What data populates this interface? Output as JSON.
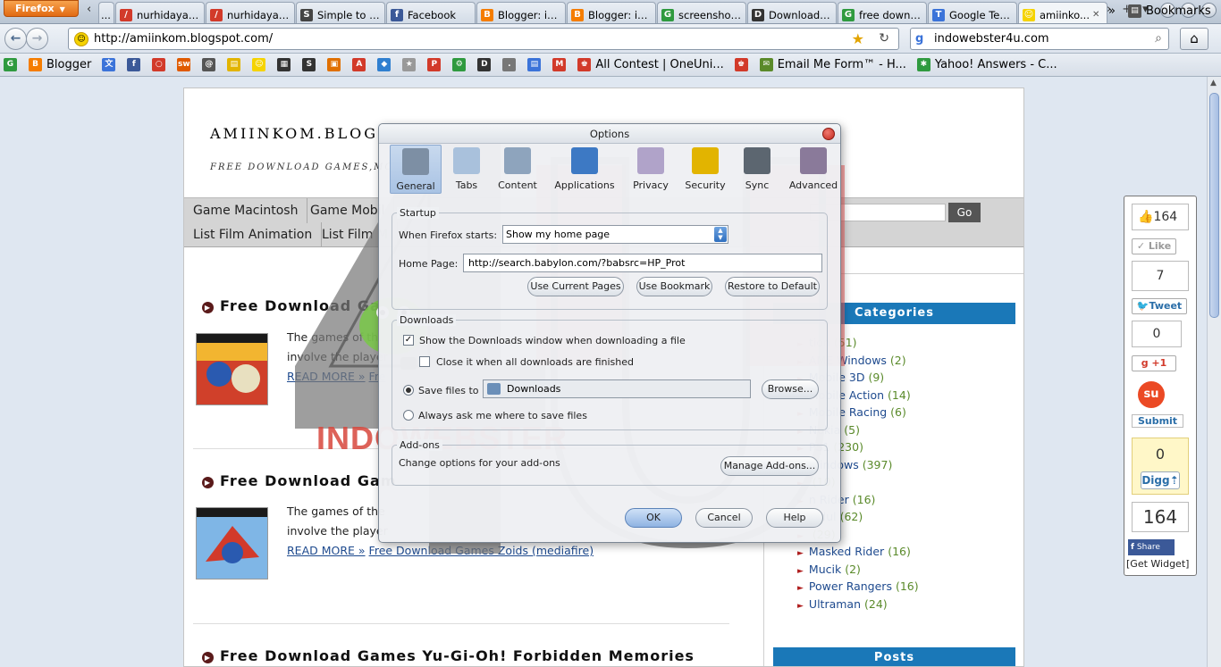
{
  "browser": {
    "menu_button": "Firefox",
    "tabs": [
      {
        "label": "...",
        "color": "#cfd8e4",
        "glyph": ""
      },
      {
        "label": "nurhidayat...",
        "color": "#d23a2a",
        "glyph": "/"
      },
      {
        "label": "nurhidayat...",
        "color": "#d23a2a",
        "glyph": "/"
      },
      {
        "label": "Simple to D...",
        "color": "#444444",
        "glyph": "S"
      },
      {
        "label": "Facebook",
        "color": "#3b5998",
        "glyph": "f"
      },
      {
        "label": "Blogger: in...",
        "color": "#f57d00",
        "glyph": "B"
      },
      {
        "label": "Blogger: in...",
        "color": "#f57d00",
        "glyph": "B"
      },
      {
        "label": "screenshot...",
        "color": "#2f9a3f",
        "glyph": "G"
      },
      {
        "label": "Download F...",
        "color": "#333333",
        "glyph": "D"
      },
      {
        "label": "free downl...",
        "color": "#2f9a3f",
        "glyph": "G"
      },
      {
        "label": "Google Terj...",
        "color": "#3b73d9",
        "glyph": "T"
      },
      {
        "label": "amiinko...",
        "color": "#f5d300",
        "glyph": "☺",
        "active": true
      }
    ],
    "url": "http://amiinkom.blogspot.com/",
    "search_text": "indowebster4u.com",
    "bookmarks": [
      {
        "label": "",
        "color": "#2f9a3f",
        "glyph": "G"
      },
      {
        "label": "Blogger",
        "color": "#f57d00",
        "glyph": "B"
      },
      {
        "label": "",
        "color": "#3b73d9",
        "glyph": "文"
      },
      {
        "label": "",
        "color": "#3b5998",
        "glyph": "f"
      },
      {
        "label": "",
        "color": "#d23a2a",
        "glyph": "○"
      },
      {
        "label": "",
        "color": "#e05a00",
        "glyph": "sw"
      },
      {
        "label": "",
        "color": "#555555",
        "glyph": "@"
      },
      {
        "label": "",
        "color": "#e2b400",
        "glyph": "▤"
      },
      {
        "label": "",
        "color": "#f5d300",
        "glyph": "☺"
      },
      {
        "label": "",
        "color": "#333333",
        "glyph": "▦"
      },
      {
        "label": "",
        "color": "#333333",
        "glyph": "S"
      },
      {
        "label": "",
        "color": "#e07000",
        "glyph": "▣"
      },
      {
        "label": "",
        "color": "#d23a2a",
        "glyph": "A"
      },
      {
        "label": "",
        "color": "#2f7fd0",
        "glyph": "◆"
      },
      {
        "label": "",
        "color": "#999999",
        "glyph": "★"
      },
      {
        "label": "",
        "color": "#d23a2a",
        "glyph": "P"
      },
      {
        "label": "",
        "color": "#2f9a3f",
        "glyph": "⚙"
      },
      {
        "label": "",
        "color": "#333333",
        "glyph": "D"
      },
      {
        "label": "",
        "color": "#777777",
        "glyph": "."
      },
      {
        "label": "",
        "color": "#3b73d9",
        "glyph": "▤"
      },
      {
        "label": "",
        "color": "#d23a2a",
        "glyph": "M"
      },
      {
        "label": "All Contest | OneUni...",
        "color": "#d23a2a",
        "glyph": "♚"
      },
      {
        "label": "",
        "color": "#d23a2a",
        "glyph": "♚"
      },
      {
        "label": "Email Me Form™ - H...",
        "color": "#5a8a2a",
        "glyph": "✉"
      },
      {
        "label": "Yahoo! Answers - C...",
        "color": "#2f9a3f",
        "glyph": "✱"
      }
    ],
    "bookmarks_more": "»",
    "bookmarks_menu": "Bookmarks"
  },
  "blog": {
    "title": "AMIINKOM.BLOGS",
    "description": "FREE DOWNLOAD GAMES,MOV",
    "menu_row1": [
      "Game Macintosh",
      "Game Mobil"
    ],
    "menu_row2": [
      "List Film Animation",
      "List Film M"
    ],
    "search_button": "Go",
    "posts": [
      {
        "title": "Free Download Gam",
        "line1": "The games of the",
        "line2": "involve the player",
        "read_more": "READ MORE »",
        "link": "Fre",
        "thumb_colors": [
          "#f2b530",
          "#d0402a"
        ]
      },
      {
        "title": "Free Download Gam",
        "line1": "The games of the",
        "line2": "involve the player",
        "read_more": "READ MORE »",
        "link": "Free Download Games Zoids (mediafire)",
        "thumb_colors": [
          "#7fb6e6",
          "#d23a2a"
        ]
      },
      {
        "title": "Free Download Games Yu-Gi-Oh! Forbidden Memories"
      }
    ],
    "categories_title": "Categories",
    "categories": [
      {
        "name": "tion",
        "count": "(51)"
      },
      {
        "name": "AME Windows",
        "count": "(2)"
      },
      {
        "name": "Mobile 3D",
        "count": "(9)"
      },
      {
        "name": "Mobile Action",
        "count": "(14)"
      },
      {
        "name": "Mobile Racing",
        "count": "(6)"
      },
      {
        "name": "Nokia",
        "count": "(5)"
      },
      {
        "name": "PS1",
        "count": "(230)"
      },
      {
        "name": "Windows",
        "count": "(397)"
      },
      {
        "name": "",
        "count": "(10)"
      },
      {
        "name": "n Rider",
        "count": "(16)"
      },
      {
        "name": "Jadul",
        "count": "(62)"
      },
      {
        "name": "",
        "count": "(29)"
      },
      {
        "name": "Masked Rider",
        "count": "(16)"
      },
      {
        "name": "Mucik",
        "count": "(2)"
      },
      {
        "name": "Power Rangers",
        "count": "(16)"
      },
      {
        "name": "Ultraman",
        "count": "(24)"
      }
    ],
    "posts_title": "Posts"
  },
  "share": {
    "fb_count": "164",
    "like": "Like",
    "tweet_count": "7",
    "tweet": "Tweet",
    "gplus_count": "0",
    "gplus": "+1",
    "stumble": "Submit",
    "digg_count": "0",
    "digg": "Digg",
    "share_count": "164",
    "share": "Share",
    "get_widget": "[Get Widget]"
  },
  "watermark": {
    "text": "INDOWEBSTER"
  },
  "dialog": {
    "title": "Options",
    "panes": [
      {
        "label": "General",
        "color": "#7d8fa4",
        "selected": true
      },
      {
        "label": "Tabs",
        "color": "#a9c1dc"
      },
      {
        "label": "Content",
        "color": "#8ea4bd"
      },
      {
        "label": "Applications",
        "color": "#3d79c4"
      },
      {
        "label": "Privacy",
        "color": "#b0a3c9"
      },
      {
        "label": "Security",
        "color": "#e2b400"
      },
      {
        "label": "Sync",
        "color": "#5c6670"
      },
      {
        "label": "Advanced",
        "color": "#8a7a9a"
      }
    ],
    "startup_label": "Startup",
    "when_starts_label": "When Firefox starts:",
    "when_starts_value": "Show my home page",
    "home_page_label": "Home Page:",
    "home_page_value": "http://search.babylon.com/?babsrc=HP_Prot",
    "use_current": "Use Current Pages",
    "use_bookmark": "Use Bookmark",
    "restore_default": "Restore to Default",
    "downloads_label": "Downloads",
    "show_downloads": "Show the Downloads window when downloading a file",
    "close_when_done": "Close it when all downloads are finished",
    "save_files_to": "Save files to",
    "save_folder": "Downloads",
    "browse": "Browse...",
    "always_ask": "Always ask me where to save files",
    "addons_label": "Add-ons",
    "addons_text": "Change options for your add-ons",
    "manage_addons": "Manage Add-ons...",
    "ok": "OK",
    "cancel": "Cancel",
    "help": "Help"
  }
}
